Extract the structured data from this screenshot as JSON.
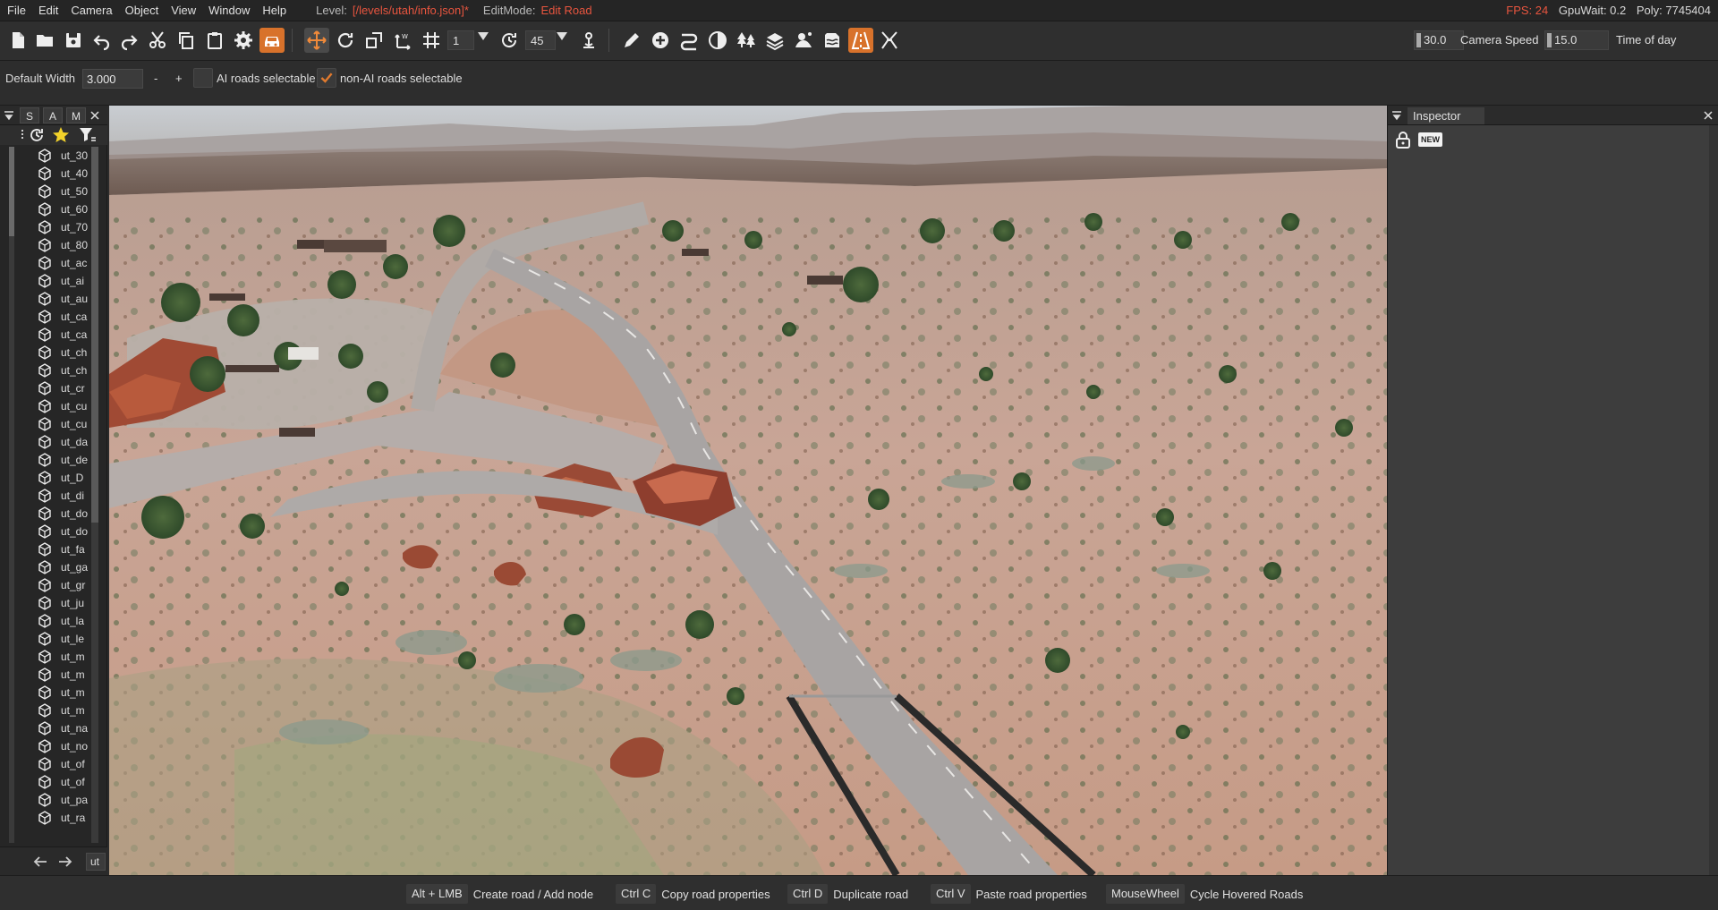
{
  "menu": {
    "items": [
      "File",
      "Edit",
      "Camera",
      "Object",
      "View",
      "Window",
      "Help"
    ],
    "level_label": "Level:",
    "level_value": "[/levels/utah/info.json]*",
    "editmode_label": "EditMode:",
    "editmode_value": "Edit Road",
    "fps_label": "FPS: 24",
    "gpuwait": "GpuWait: 0.2",
    "poly": "Poly: 7745404"
  },
  "toolbar": {
    "snap_value": "1",
    "rotation_snap": "45",
    "camera_speed_value": "30.0",
    "camera_speed_label": "Camera Speed",
    "time_of_day_value": "15.0",
    "time_of_day_label": "Time of day"
  },
  "options": {
    "default_width_label": "Default Width",
    "default_width_value": "3.000",
    "minus": "-",
    "plus": "+",
    "ai_roads_label": "AI roads selectable",
    "ai_roads_checked": false,
    "non_ai_roads_label": "non-AI roads selectable",
    "non_ai_roads_checked": true
  },
  "left_panel": {
    "tabs": [
      "S",
      "A",
      "M"
    ],
    "items": [
      "ut_30",
      "ut_40",
      "ut_50",
      "ut_60",
      "ut_70",
      "ut_80",
      "ut_ac",
      "ut_ai",
      "ut_au",
      "ut_ca",
      "ut_ca",
      "ut_ch",
      "ut_ch",
      "ut_cr",
      "ut_cu",
      "ut_cu",
      "ut_da",
      "ut_de",
      "ut_D",
      "ut_di",
      "ut_do",
      "ut_do",
      "ut_fa",
      "ut_ga",
      "ut_gr",
      "ut_ju",
      "ut_la",
      "ut_le",
      "ut_m",
      "ut_m",
      "ut_m",
      "ut_m",
      "ut_na",
      "ut_no",
      "ut_of",
      "ut_of",
      "ut_pa",
      "ut_ra"
    ],
    "search_value": "ut"
  },
  "inspector": {
    "title": "Inspector",
    "new_badge": "NEW"
  },
  "status": {
    "hints": [
      {
        "key": "Alt + LMB",
        "desc": "Create road / Add node"
      },
      {
        "key": "Ctrl C",
        "desc": "Copy road properties"
      },
      {
        "key": "Ctrl D",
        "desc": "Duplicate road"
      },
      {
        "key": "Ctrl V",
        "desc": "Paste road properties"
      },
      {
        "key": "MouseWheel",
        "desc": "Cycle Hovered Roads"
      }
    ]
  },
  "colors": {
    "accent": "#e8553f",
    "active_tool": "#d8722b",
    "check": "#e07a2e"
  }
}
